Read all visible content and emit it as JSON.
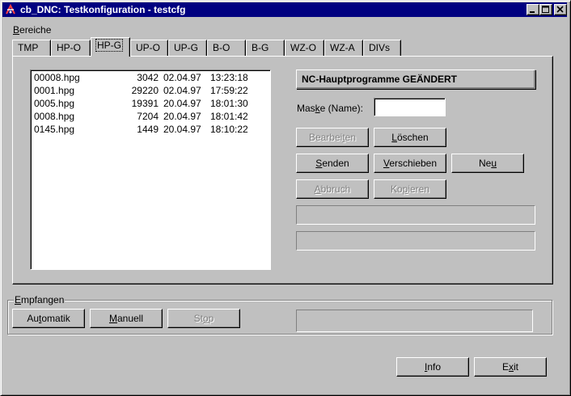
{
  "window": {
    "title": "cb_DNC: Testkonfiguration - testcfg"
  },
  "areas": {
    "label_prefix": "",
    "label_u": "B",
    "label_rest": "ereiche",
    "tabs": [
      "TMP",
      "HP-O",
      "HP-G",
      "UP-O",
      "UP-G",
      "B-O",
      "B-G",
      "WZ-O",
      "WZ-A",
      "DIVs"
    ],
    "active_tab": "HP-G"
  },
  "files": [
    {
      "name": "00008.hpg",
      "size": "3042",
      "date": "02.04.97",
      "time": "13:23:18"
    },
    {
      "name": "0001.hpg",
      "size": "29220",
      "date": "02.04.97",
      "time": "17:59:22"
    },
    {
      "name": "0005.hpg",
      "size": "19391",
      "date": "20.04.97",
      "time": "18:01:30"
    },
    {
      "name": "0008.hpg",
      "size": "7204",
      "date": "20.04.97",
      "time": "18:01:42"
    },
    {
      "name": "0145.hpg",
      "size": "1449",
      "date": "20.04.97",
      "time": "18:10:22"
    }
  ],
  "panel": {
    "heading": "NC-Hauptprogramme GEÄNDERT",
    "mask_pre": "Mas",
    "mask_u": "k",
    "mask_post": "e (Name):",
    "mask_value": ""
  },
  "buttons": {
    "edit": {
      "pre": "Bearbei",
      "u": "t",
      "post": "en"
    },
    "delete": {
      "pre": "",
      "u": "L",
      "post": "öschen"
    },
    "send": {
      "pre": "",
      "u": "S",
      "post": "enden"
    },
    "move": {
      "pre": "",
      "u": "V",
      "post": "erschieben"
    },
    "new": {
      "pre": "Ne",
      "u": "u",
      "post": ""
    },
    "abort": {
      "pre": "",
      "u": "A",
      "post": "bbruch"
    },
    "copy": {
      "pre": "Ko",
      "u": "p",
      "post": "ieren"
    },
    "auto": {
      "pre": "Au",
      "u": "t",
      "post": "omatik"
    },
    "manual": {
      "pre": "",
      "u": "M",
      "post": "anuell"
    },
    "stop": {
      "pre": "St",
      "u": "o",
      "post": "p"
    },
    "info": {
      "pre": "",
      "u": "I",
      "post": "nfo"
    },
    "exit": {
      "pre": "E",
      "u": "x",
      "post": "it"
    }
  },
  "receive": {
    "label_pre": "",
    "label_u": "E",
    "label_post": "mpfangen"
  },
  "colors": {
    "titlebar": "#000080",
    "face": "#c0c0c0"
  }
}
